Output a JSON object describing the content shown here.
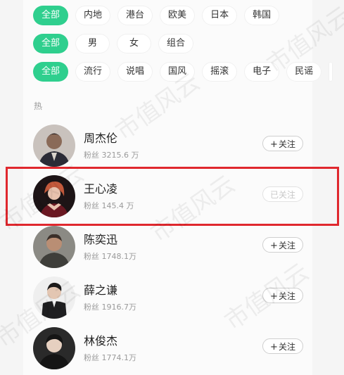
{
  "filters": {
    "region": [
      "全部",
      "内地",
      "港台",
      "欧美",
      "日本",
      "韩国"
    ],
    "gender": [
      "全部",
      "男",
      "女",
      "组合"
    ],
    "genre": [
      "全部",
      "流行",
      "说唱",
      "国风",
      "摇滚",
      "电子",
      "民谣",
      ""
    ]
  },
  "section_title": "热",
  "artists": [
    {
      "name": "周杰伦",
      "fans": "粉丝 3215.6 万",
      "follow_label": "关注",
      "followed": false
    },
    {
      "name": "王心凌",
      "fans": "粉丝 145.4 万",
      "follow_label": "已关注",
      "followed": true
    },
    {
      "name": "陈奕迅",
      "fans": "粉丝 1748.1万",
      "follow_label": "关注",
      "followed": false
    },
    {
      "name": "薛之谦",
      "fans": "粉丝 1916.7万",
      "follow_label": "关注",
      "followed": false
    },
    {
      "name": "林俊杰",
      "fans": "粉丝 1774.1万",
      "follow_label": "关注",
      "followed": false
    }
  ],
  "watermark_text": "市值风云",
  "colors": {
    "accent": "#2fcf8e",
    "highlight": "#e0282e"
  }
}
